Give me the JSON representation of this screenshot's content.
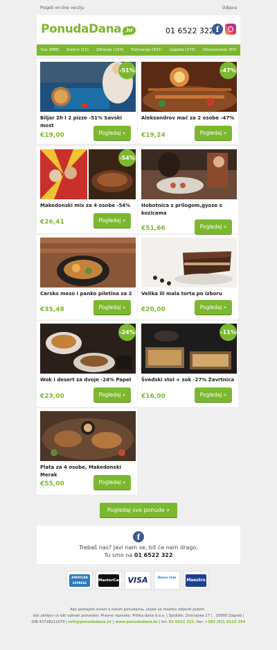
{
  "top": {
    "online": "Posjeti on-line verziju",
    "unsubscribe": "Odjava"
  },
  "header": {
    "logo_word": "PonudaDana",
    "logo_tag": ".hr",
    "phone": "01 6522 322"
  },
  "nav": [
    "Sve (888)",
    "Gastro (12)",
    "Zdravlje (164)",
    "Putovanja (431)",
    "Ljepota (175)",
    "Obrazovanje (65)"
  ],
  "offers": [
    {
      "title": "Biljar 2h i 2 pizze -51% Savski most",
      "price": "€19,00",
      "button": "Pogledaj »",
      "badge": "-51%"
    },
    {
      "title": "Aleksandrov mač za 2 osobe -47%",
      "price": "€19,24",
      "button": "Pogledaj »",
      "badge": "-47%"
    },
    {
      "title": "Makedonski mix za 4 osobe -54%",
      "price": "€26,41",
      "button": "Pogledaj »",
      "badge": "-54%"
    },
    {
      "title": "Hobotnica s prilogom,gyoze s kozicama",
      "price": "€51,66",
      "button": "Pogledaj »",
      "badge": ""
    },
    {
      "title": "Carsko meso i panko piletina za 2",
      "price": "€35,48",
      "button": "Pogledaj »",
      "badge": ""
    },
    {
      "title": "Velika ili mala torta po izboru",
      "price": "€20,00",
      "button": "Pogledaj »",
      "badge": ""
    },
    {
      "title": "Wok i desert za dvoje -24% Papel",
      "price": "€23,00",
      "button": "Pogledaj »",
      "badge": "-24%"
    },
    {
      "title": "Švedski stol + sok -27% Zavrtnica",
      "price": "€16,00",
      "button": "Pogledaj »",
      "badge": "-11%"
    },
    {
      "title": "Plata za 4 osobe, Makedonski Merak",
      "price": "€55,00",
      "button": "Pogledaj »",
      "badge": ""
    }
  ],
  "all_offers": "Pogledaj sve ponude »",
  "contact": {
    "line1": "Trebaš nas? Javi nam se, bit će nam drago.",
    "line2_prefix": "Tu smo na",
    "line2_phone": "01 6522 322"
  },
  "payments": [
    "AMERICAN EXPRESS",
    "MasterCard",
    "VISA",
    "Diners Club",
    "Maestro"
  ],
  "footer": {
    "line1": "Ako postajete ovisni o našim ponudama, uvijek se možete odjaviti putem .",
    "line2": "Vaš zahtjev će biti odmah proveden. Pravne naznake. Prilika dana d.o.o. | Sjedište: Zvečajska 17 | , 10000 Zagreb |",
    "line3a": "OIB 43728211079 |",
    "email": "info@ponudadana.hr",
    "sep1": "|",
    "site": "www.ponudadana.hr",
    "sep2": "| tel:",
    "tel": "01 6522 322",
    "fax_label": ", fax:",
    "fax": "+385 (0)1 6522 264"
  },
  "colors": {
    "accent": "#7cb82f",
    "facebook": "#3b5998"
  }
}
